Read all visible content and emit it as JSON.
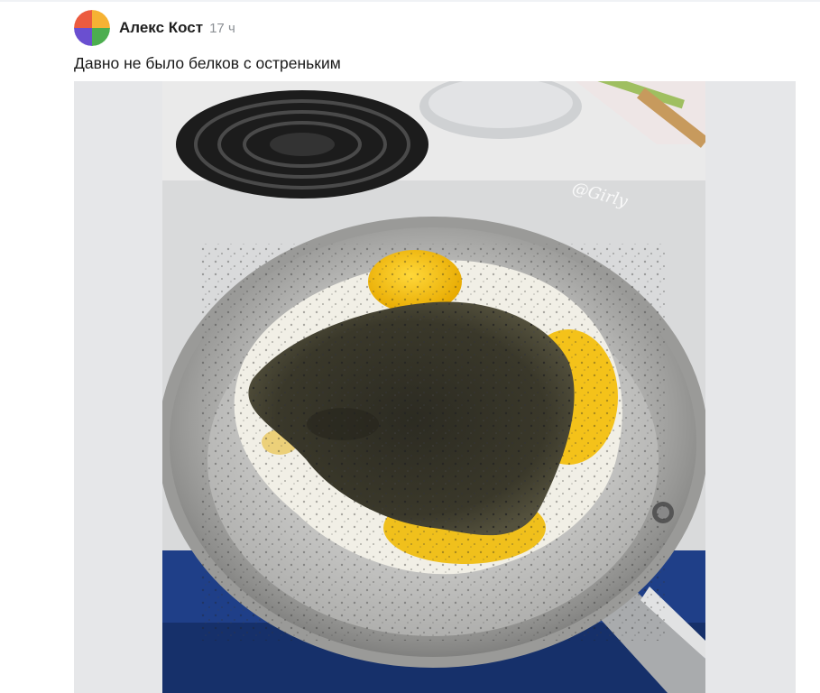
{
  "post": {
    "author": "Алекс Кост",
    "time": "17 ч",
    "text": "Давно не было белков с остреньким"
  },
  "media": {
    "watermark": "@Girly",
    "icon": "photo-icon"
  },
  "avatar": {
    "icon": "avatar-icon"
  }
}
